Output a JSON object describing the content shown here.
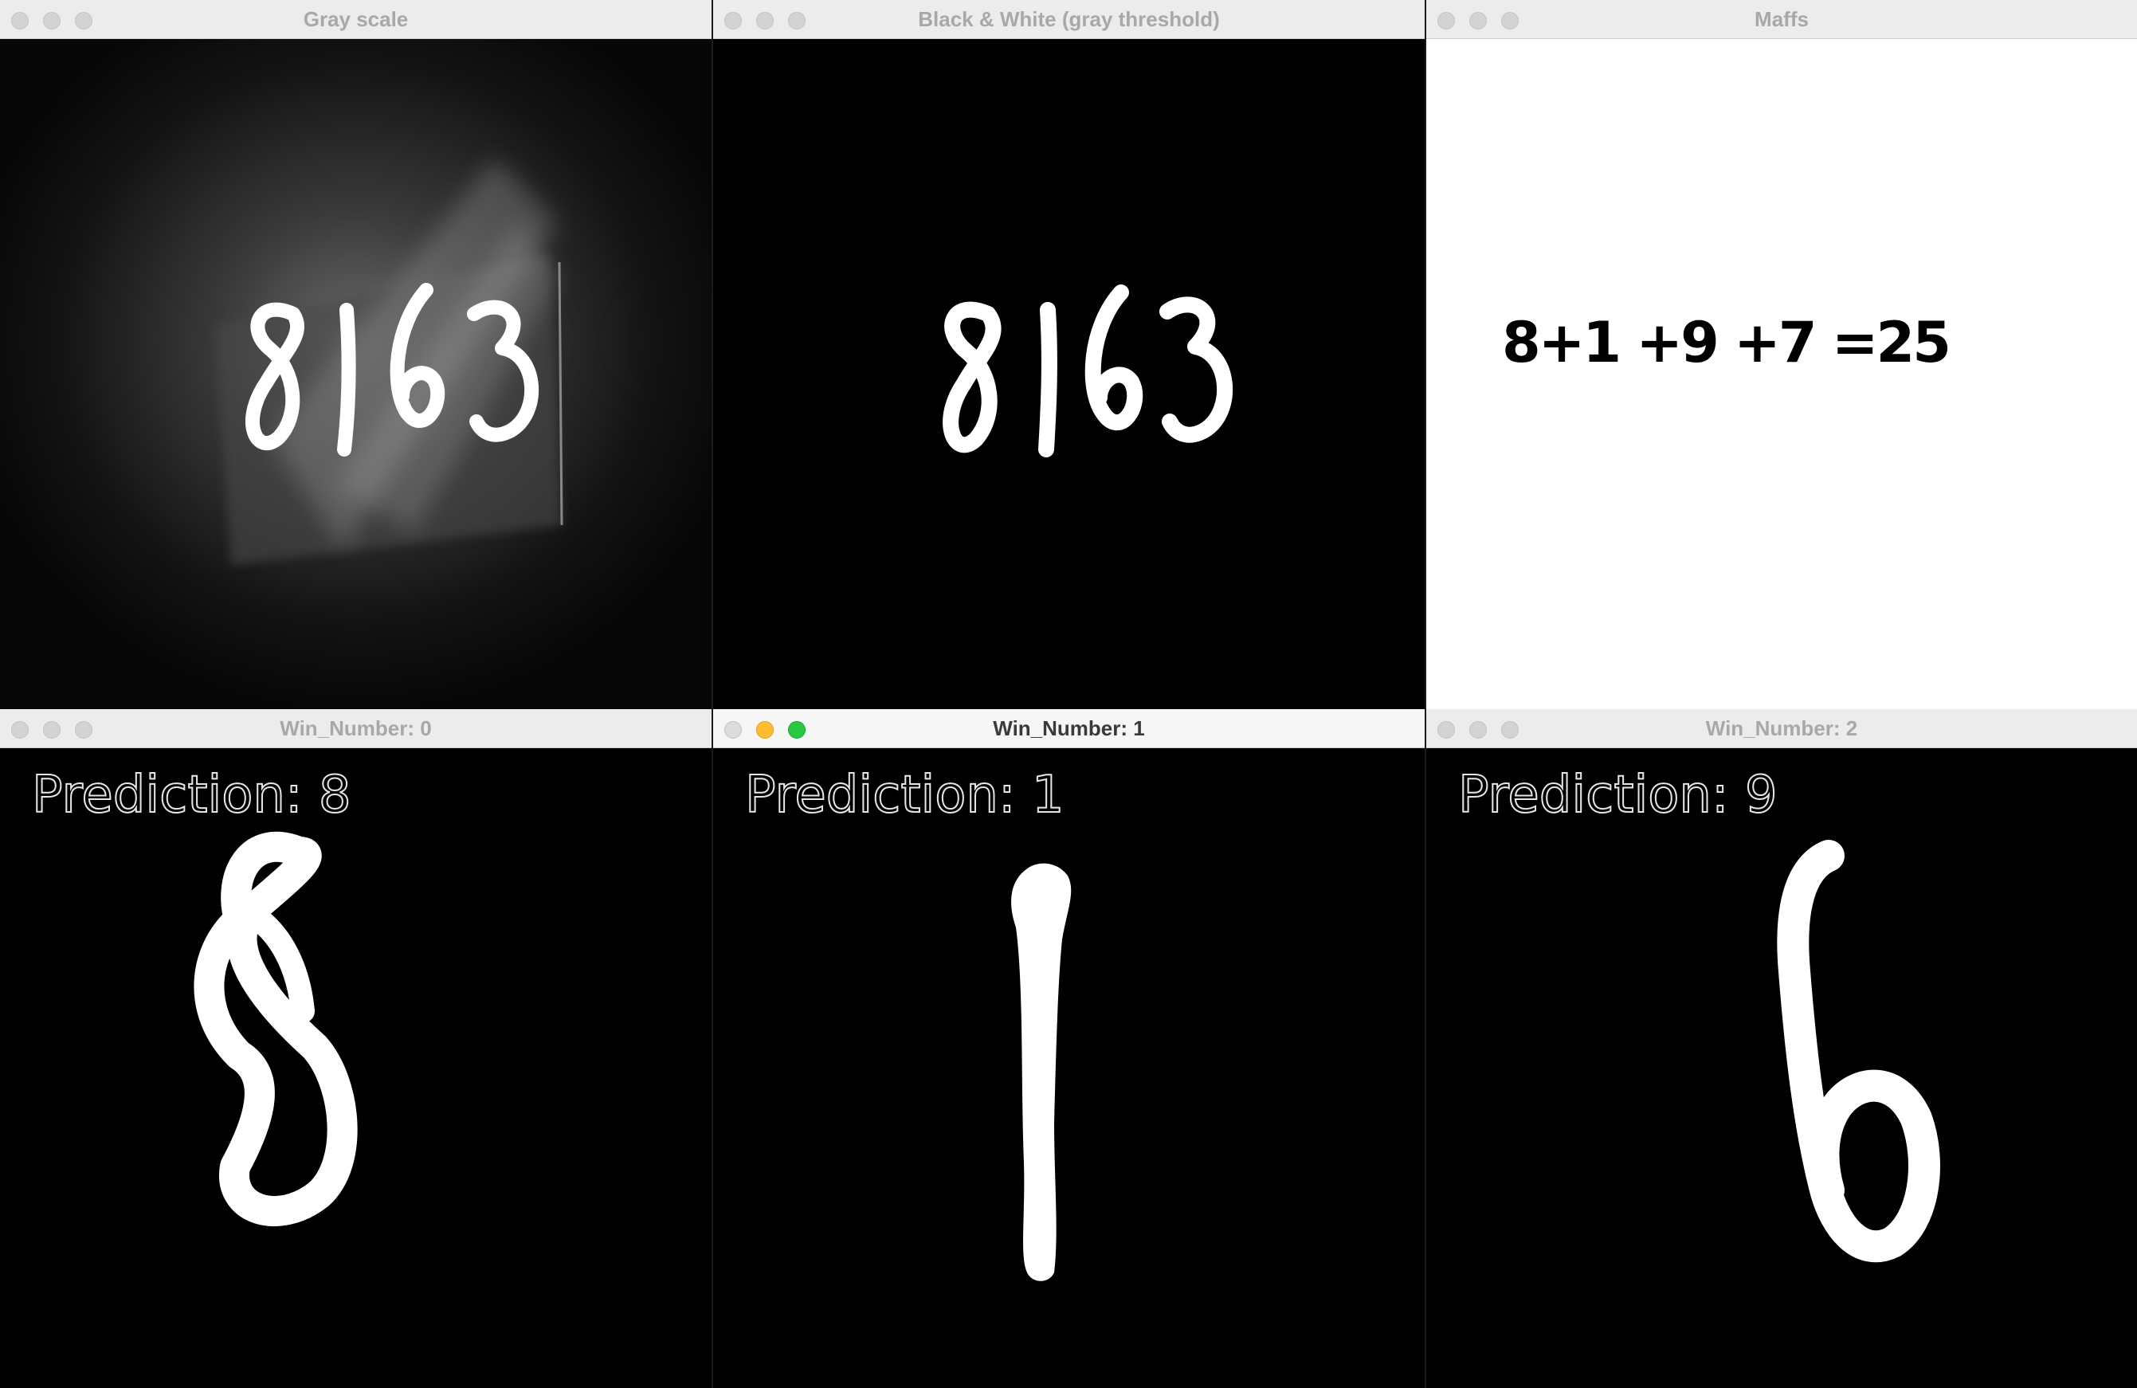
{
  "windows": {
    "gray": {
      "title": "Gray scale",
      "digits": "8163"
    },
    "bw": {
      "title": "Black & White (gray threshold)",
      "digits": "8163"
    },
    "maffs": {
      "title": "Maffs",
      "equation": "8+1 +9 +7 =25"
    },
    "win0": {
      "title": "Win_Number: 0",
      "prediction_label": "Prediction:  8"
    },
    "win1": {
      "title": "Win_Number: 1",
      "prediction_label": "Prediction:  1"
    },
    "win2": {
      "title": "Win_Number: 2",
      "prediction_label": "Prediction:  9"
    }
  },
  "colors": {
    "titlebar": "#ececec",
    "traffic_yellow": "#febc2e",
    "traffic_green": "#28c840",
    "canvas_black": "#000000",
    "canvas_white": "#ffffff"
  }
}
